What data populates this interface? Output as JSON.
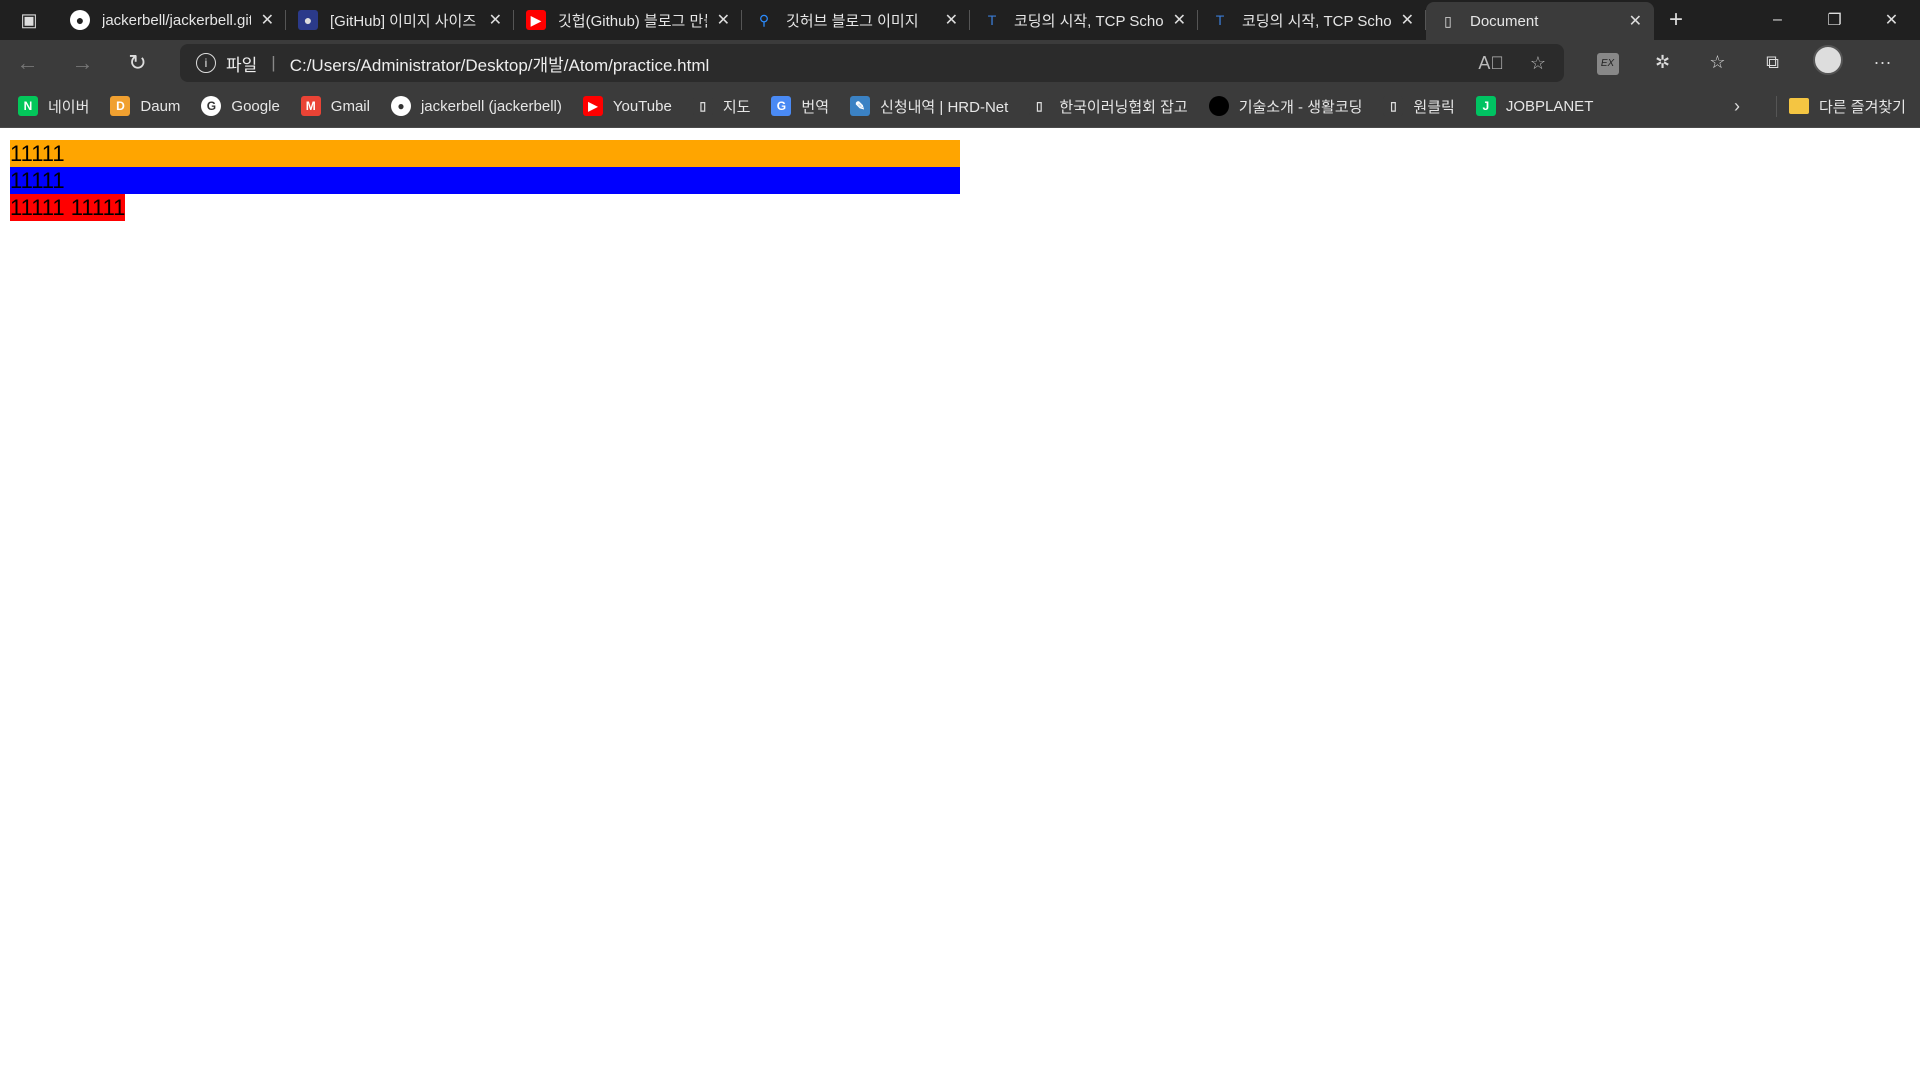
{
  "browser": {
    "tabs": [
      {
        "title": "jackerbell/jackerbell.github.io",
        "icon": "github-icon"
      },
      {
        "title": "[GitHub] 이미지 사이즈",
        "icon": "site-icon"
      },
      {
        "title": "깃헙(Github) 블로그 만들기",
        "icon": "youtube-icon"
      },
      {
        "title": "깃허브 블로그 이미지",
        "icon": "search-icon"
      },
      {
        "title": "코딩의 시작, TCP School",
        "icon": "tcpschool-icon"
      },
      {
        "title": "코딩의 시작, TCP School",
        "icon": "tcpschool-icon"
      },
      {
        "title": "Document",
        "icon": "page-icon",
        "active": true
      }
    ],
    "address": {
      "scheme_label": "파일",
      "url": "C:/Users/Administrator/Desktop/개발/Atom/practice.html"
    },
    "bookmarks": [
      {
        "label": "네이버",
        "icon": "naver-icon",
        "color": "#03c75a",
        "glyph": "N"
      },
      {
        "label": "Daum",
        "icon": "daum-icon",
        "color": "#f0a030",
        "glyph": "D"
      },
      {
        "label": "Google",
        "icon": "google-icon",
        "color": "#ffffff",
        "glyph": "G"
      },
      {
        "label": "Gmail",
        "icon": "gmail-icon",
        "color": "#ea4335",
        "glyph": "M"
      },
      {
        "label": "jackerbell (jackerbell)",
        "icon": "github-icon",
        "color": "#ffffff",
        "glyph": "●"
      },
      {
        "label": "YouTube",
        "icon": "youtube-icon",
        "color": "#ff0000",
        "glyph": "▶"
      },
      {
        "label": "지도",
        "icon": "page-icon",
        "color": "#3b3b3b",
        "glyph": "▯"
      },
      {
        "label": "번역",
        "icon": "translate-icon",
        "color": "#4a8af4",
        "glyph": "G"
      },
      {
        "label": "신청내역 | HRD-Net",
        "icon": "hrdnet-icon",
        "color": "#3b82c4",
        "glyph": "✎"
      },
      {
        "label": "한국이러닝협회 잡고",
        "icon": "page-icon",
        "color": "#3b3b3b",
        "glyph": "▯"
      },
      {
        "label": "기술소개 - 생활코딩",
        "icon": "circle-icon",
        "color": "#000000",
        "glyph": ""
      },
      {
        "label": "원클릭",
        "icon": "page-icon",
        "color": "#3b3b3b",
        "glyph": "▯"
      },
      {
        "label": "JOBPLANET",
        "icon": "jobplanet-icon",
        "color": "#00c362",
        "glyph": "J"
      }
    ],
    "other_bookmarks": "다른 즐겨찾기"
  },
  "page": {
    "boxes": [
      {
        "text": "11111",
        "color": "#ffa500"
      },
      {
        "text": "11111",
        "color": "#0000ff"
      },
      {
        "text": "11111 11111",
        "color": "#ff0000"
      }
    ]
  }
}
